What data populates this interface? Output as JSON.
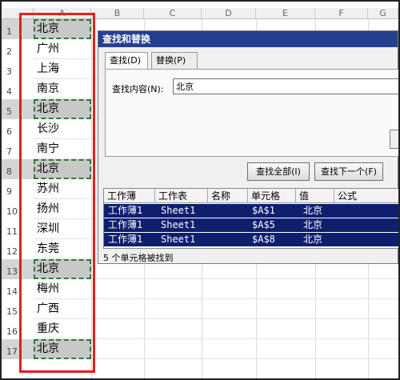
{
  "columns": [
    "A",
    "B",
    "C",
    "D",
    "E",
    "F",
    "G"
  ],
  "rows": [
    {
      "num": "1",
      "value": "北京",
      "hit": true
    },
    {
      "num": "2",
      "value": "广州",
      "hit": false
    },
    {
      "num": "3",
      "value": "上海",
      "hit": false
    },
    {
      "num": "4",
      "value": "南京",
      "hit": false
    },
    {
      "num": "5",
      "value": "北京",
      "hit": true
    },
    {
      "num": "6",
      "value": "长沙",
      "hit": false
    },
    {
      "num": "7",
      "value": "南宁",
      "hit": false
    },
    {
      "num": "8",
      "value": "北京",
      "hit": true
    },
    {
      "num": "9",
      "value": "苏州",
      "hit": false
    },
    {
      "num": "10",
      "value": "扬州",
      "hit": false
    },
    {
      "num": "11",
      "value": "深圳",
      "hit": false
    },
    {
      "num": "12",
      "value": "东莞",
      "hit": false
    },
    {
      "num": "13",
      "value": "北京",
      "hit": true
    },
    {
      "num": "14",
      "value": "梅州",
      "hit": false
    },
    {
      "num": "15",
      "value": "广西",
      "hit": false
    },
    {
      "num": "16",
      "value": "重庆",
      "hit": false
    },
    {
      "num": "17",
      "value": "北京",
      "hit": true
    }
  ],
  "dialog": {
    "title": "查找和替换",
    "tabs": [
      {
        "label": "查找(D)",
        "active": true
      },
      {
        "label": "替换(P)",
        "active": false
      }
    ],
    "find_label": "查找内容(N):",
    "find_value": "北京",
    "find_all_label": "查找全部(I)",
    "find_next_label": "查找下一个(F)",
    "result_headers": [
      "工作薄",
      "工作表",
      "名称",
      "单元格",
      "值",
      "公式"
    ],
    "results": [
      [
        "工作薄1",
        "Sheet1",
        "",
        "$A$1",
        "北京",
        ""
      ],
      [
        "工作薄1",
        "Sheet1",
        "",
        "$A$5",
        "北京",
        ""
      ],
      [
        "工作薄1",
        "Sheet1",
        "",
        "$A$8",
        "北京",
        ""
      ]
    ],
    "status": "5 个单元格被找到"
  },
  "colors": {
    "title_bar": "#243f8f",
    "selection": "#0e1f6e",
    "highlight_border": "#e02020",
    "match_outline": "#2e7d32"
  }
}
